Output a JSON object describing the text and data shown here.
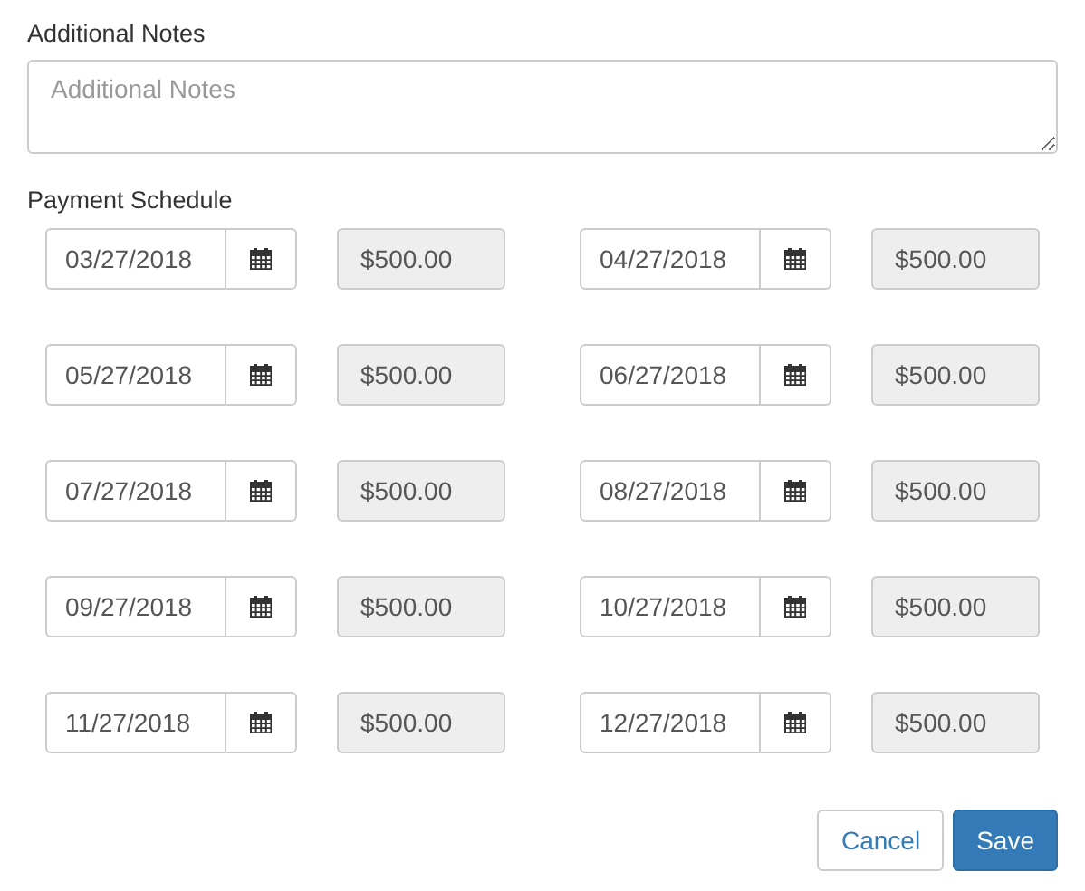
{
  "notes": {
    "label": "Additional Notes",
    "placeholder": "Additional Notes"
  },
  "schedule": {
    "label": "Payment Schedule",
    "payments": [
      {
        "date": "03/27/2018",
        "amount": "$500.00",
        "readonly": true
      },
      {
        "date": "04/27/2018",
        "amount": "$500.00",
        "readonly": true
      },
      {
        "date": "05/27/2018",
        "amount": "$500.00",
        "readonly": true
      },
      {
        "date": "06/27/2018",
        "amount": "$500.00",
        "readonly": true
      },
      {
        "date": "07/27/2018",
        "amount": "$500.00",
        "readonly": true
      },
      {
        "date": "08/27/2018",
        "amount": "$500.00",
        "readonly": true
      },
      {
        "date": "09/27/2018",
        "amount": "$500.00",
        "readonly": true
      },
      {
        "date": "10/27/2018",
        "amount": "$500.00",
        "readonly": true
      },
      {
        "date": "11/27/2018",
        "amount": "$500.00",
        "readonly": true
      },
      {
        "date": "12/27/2018",
        "amount": "$500.00",
        "readonly": true
      }
    ]
  },
  "buttons": [
    {
      "label": "Cancel",
      "kind": "default"
    },
    {
      "label": "Save",
      "kind": "primary"
    }
  ]
}
